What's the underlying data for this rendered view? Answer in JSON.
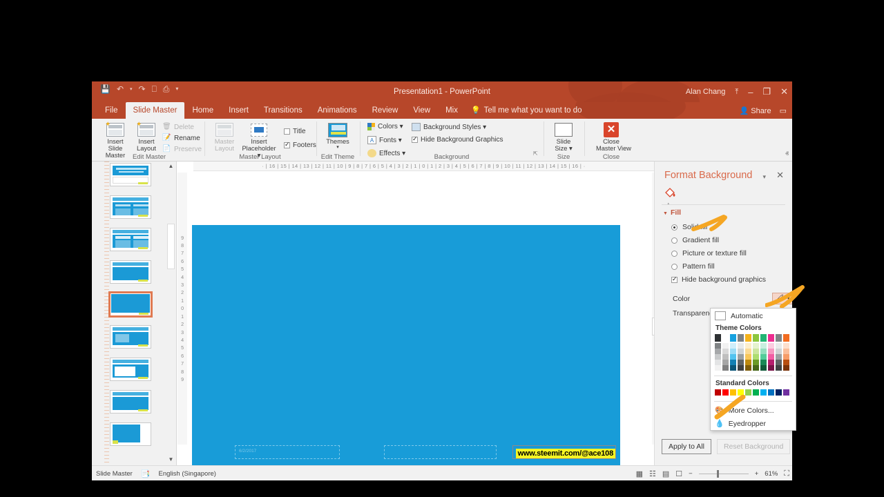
{
  "window": {
    "title": "Presentation1  -  PowerPoint",
    "user": "Alan Chang",
    "share_label": "Share",
    "quick_access": [
      "save-icon",
      "undo-icon",
      "redo-icon",
      "start-presentation-icon",
      "new-slide-icon",
      "customize-icon"
    ],
    "minimize": "–",
    "restore": "❐",
    "close": "✕",
    "upload_icon": "⤒",
    "comment_icon": "▭"
  },
  "tabs": [
    {
      "label": "File",
      "active": false
    },
    {
      "label": "Slide Master",
      "active": true
    },
    {
      "label": "Home",
      "active": false
    },
    {
      "label": "Insert",
      "active": false
    },
    {
      "label": "Transitions",
      "active": false
    },
    {
      "label": "Animations",
      "active": false
    },
    {
      "label": "Review",
      "active": false
    },
    {
      "label": "View",
      "active": false
    },
    {
      "label": "Mix",
      "active": false
    }
  ],
  "tell_me": "Tell me what you want to do",
  "ribbon": {
    "groups": [
      {
        "name": "Edit Master"
      },
      {
        "name": "Master Layout"
      },
      {
        "name": "Edit Theme"
      },
      {
        "name": "Background"
      },
      {
        "name": "Size"
      },
      {
        "name": "Close"
      }
    ],
    "insert_slide_master": "Insert Slide\nMaster",
    "insert_slide_master_l1": "Insert Slide",
    "insert_slide_master_l2": "Master",
    "insert_layout_l1": "Insert",
    "insert_layout_l2": "Layout",
    "delete": "Delete",
    "rename": "Rename",
    "preserve": "Preserve",
    "master_layout_l1": "Master",
    "master_layout_l2": "Layout",
    "insert_placeholder_l1": "Insert",
    "insert_placeholder_l2": "Placeholder ▾",
    "title_chk": "Title",
    "footers_chk": "Footers",
    "themes_l1": "Themes",
    "themes_l2": "▾",
    "colors": "Colors ▾",
    "fonts": "Fonts ▾",
    "effects": "Effects ▾",
    "background_styles": "Background Styles ▾",
    "hide_background_graphics": "Hide Background Graphics",
    "slide_size_l1": "Slide",
    "slide_size_l2": "Size ▾",
    "close_master_l1": "Close",
    "close_master_l2": "Master View",
    "collapse_ribbon": "ⱏ"
  },
  "ruler": {
    "horizontal": "· | 16 | 15 | 14 | 13 | 12 | 11 | 10 | 9 | 8 | 7 | 6 | 5 | 4 | 3 | 2 | 1 | 0 | 1 | 2 | 3 | 4 | 5 | 6 | 7 | 8 | 9 | 10 | 11 | 12 | 13 | 14 | 15 | 16 | ·",
    "vertical": [
      "9",
      "8",
      "7",
      "6",
      "5",
      "4",
      "3",
      "2",
      "1",
      "0",
      "1",
      "2",
      "3",
      "4",
      "5",
      "6",
      "7",
      "8",
      "9"
    ]
  },
  "slide": {
    "background_color": "#189cd8",
    "date_placeholder": "6/2/2017",
    "footer_placeholder": "",
    "slide_number_text": "www.steemit.com/@ace108"
  },
  "format_background": {
    "title": "Format Background",
    "caret": "▾",
    "close": "✕",
    "fill_section": "Fill",
    "options": [
      {
        "label": "Solid fill",
        "selected": true
      },
      {
        "label": "Gradient fill",
        "selected": false
      },
      {
        "label": "Picture or texture fill",
        "selected": false
      },
      {
        "label": "Pattern fill",
        "selected": false
      }
    ],
    "hide_bg_graphics": "Hide background graphics",
    "hide_bg_graphics_checked": true,
    "color_label": "Color",
    "transparency_label": "Transparency",
    "apply_to_all": "Apply to All",
    "reset_background": "Reset Background"
  },
  "color_dropdown": {
    "automatic": "Automatic",
    "theme_colors_label": "Theme Colors",
    "standard_colors_label": "Standard Colors",
    "more_colors": "More Colors...",
    "eyedropper": "Eyedropper",
    "theme_columns": [
      [
        "#2e3133",
        "#7f8284",
        "#a6a8aa",
        "#c8cacb",
        "#e3e4e5",
        "#f2f2f2"
      ],
      [
        "#ffffff",
        "#f2f2f2",
        "#d9d9d9",
        "#bfbfbf",
        "#a6a6a6",
        "#808080"
      ],
      [
        "#17a2e0",
        "#cfeefb",
        "#9cdcf6",
        "#52c3ef",
        "#1380b3",
        "#0b5678"
      ],
      [
        "#7e8385",
        "#e8eaea",
        "#cfd3d4",
        "#9ba0a2",
        "#5f6466",
        "#3f4244"
      ],
      [
        "#f5b31b",
        "#fdeecb",
        "#fbdb95",
        "#f8c75a",
        "#bd8a0f",
        "#7e5c0a"
      ],
      [
        "#8cc63e",
        "#e5f2ce",
        "#cce69e",
        "#addd6f",
        "#6b9a27",
        "#47671a"
      ],
      [
        "#22b573",
        "#c9efdf",
        "#94dfbf",
        "#54cc9a",
        "#198857",
        "#105a3a"
      ],
      [
        "#ec2d8f",
        "#fbccdf",
        "#f799c1",
        "#f25ea4",
        "#b51e6d",
        "#781448"
      ],
      [
        "#7f8385",
        "#e8eaea",
        "#d0d3d4",
        "#9ca0a2",
        "#5f6365",
        "#3f4243"
      ],
      [
        "#f26c21",
        "#fddfcd",
        "#fabe9b",
        "#f69c68",
        "#b84f11",
        "#7b340b"
      ]
    ],
    "standard_swatches": [
      "#c00000",
      "#ff0000",
      "#ffc000",
      "#ffff00",
      "#92d050",
      "#00b050",
      "#00b0f0",
      "#0070c0",
      "#002060",
      "#7030a0"
    ]
  },
  "status_bar": {
    "view_name": "Slide Master",
    "language": "English (Singapore)",
    "zoom_percent": "61%",
    "accessibility_icon": "spell-check-icon",
    "view_icons": [
      "normal-view-icon",
      "slide-sorter-icon",
      "reading-view-icon",
      "slideshow-icon"
    ],
    "zoom_out": "−",
    "zoom_in": "+",
    "fit_slide": "⛶"
  }
}
